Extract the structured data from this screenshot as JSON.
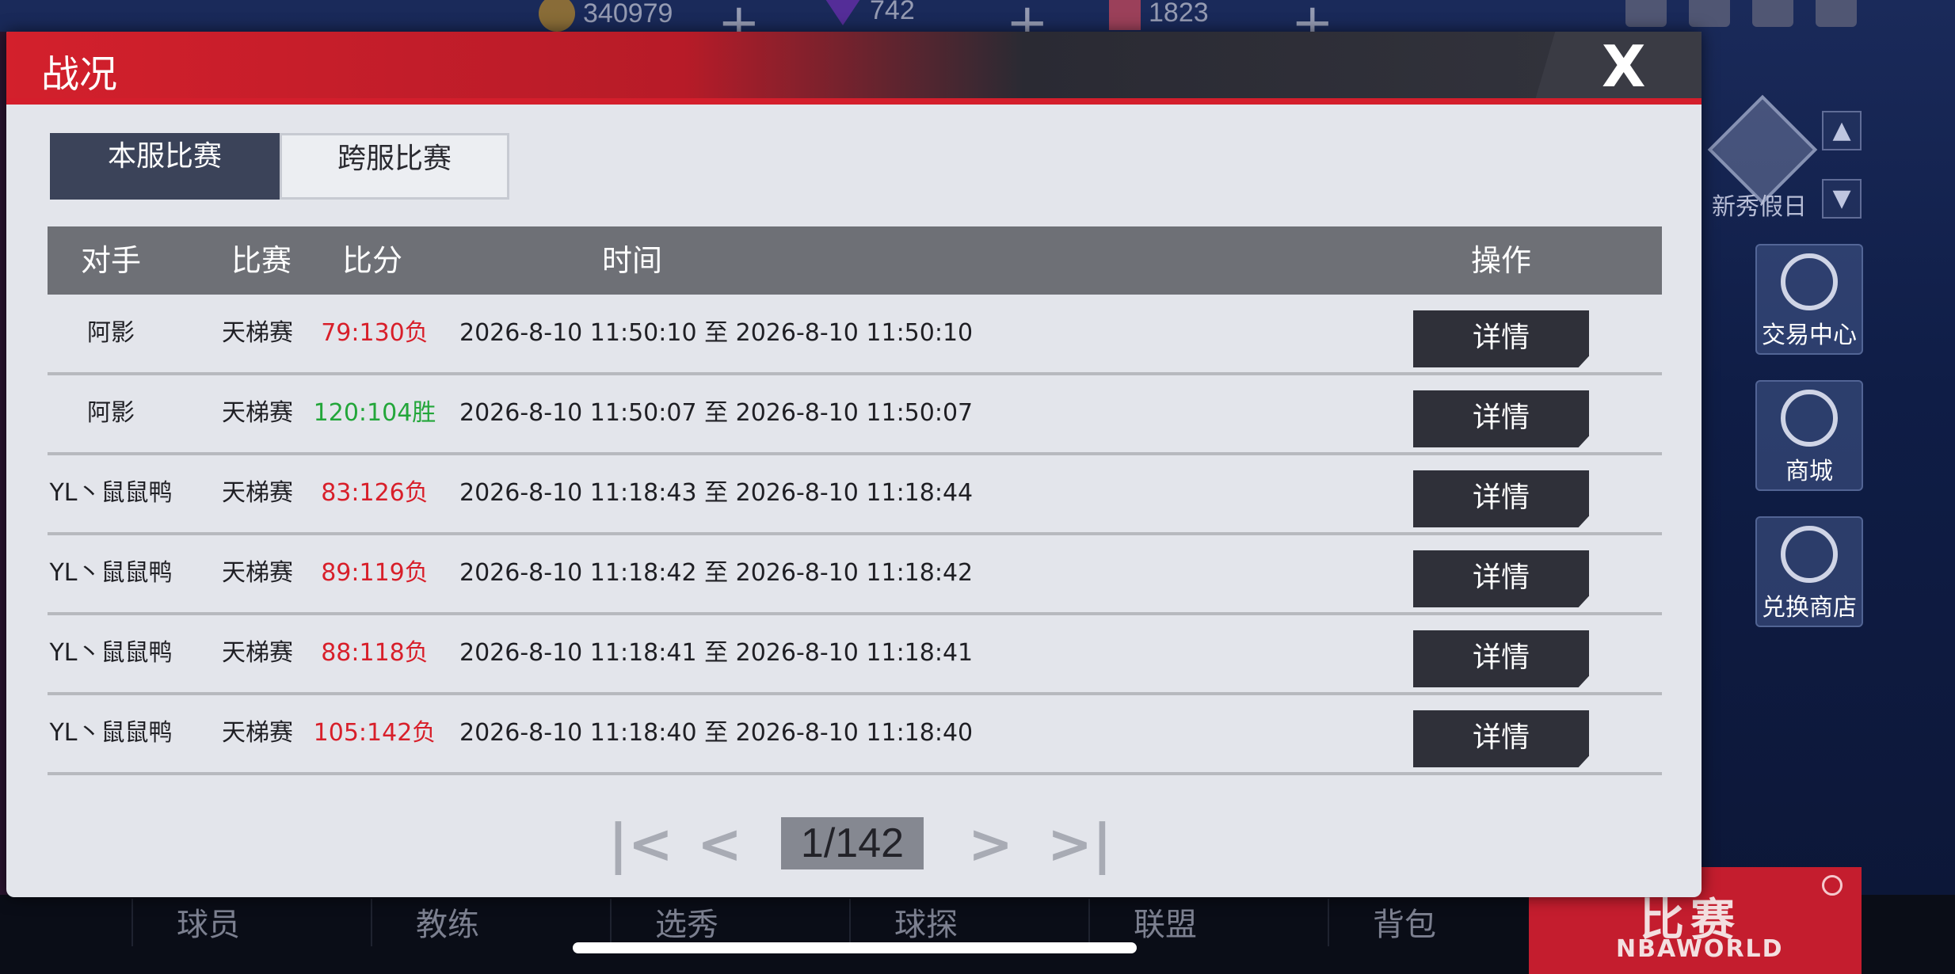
{
  "background": {
    "resources": [
      {
        "name": "coin",
        "value": "340979"
      },
      {
        "name": "gem",
        "value": "742"
      },
      {
        "name": "card",
        "value": "1823"
      }
    ],
    "side_menu": {
      "holiday": "新秀假日",
      "trade": "交易中心",
      "shop": "商城",
      "exchange": "兑换商店"
    },
    "bottom_nav": [
      "球员",
      "教练",
      "选秀",
      "球探",
      "联盟",
      "背包"
    ],
    "match_button": {
      "title": "比赛",
      "subtitle": "NBAWORLD"
    }
  },
  "dialog": {
    "title": "战况",
    "close_icon": "close-x-icon",
    "tabs": [
      {
        "label": "本服比赛",
        "active": true
      },
      {
        "label": "跨服比赛",
        "active": false
      }
    ],
    "columns": {
      "opponent": "对手",
      "match": "比赛",
      "score": "比分",
      "time": "时间",
      "action": "操作"
    },
    "rows": [
      {
        "opponent": "阿影",
        "match": "天梯赛",
        "score": "79:130负",
        "result": "lose",
        "time": "2026-8-10 11:50:10 至 2026-8-10 11:50:10",
        "action": "详情"
      },
      {
        "opponent": "阿影",
        "match": "天梯赛",
        "score": "120:104胜",
        "result": "win",
        "time": "2026-8-10 11:50:07 至 2026-8-10 11:50:07",
        "action": "详情"
      },
      {
        "opponent": "YL丶鼠鼠鸭",
        "match": "天梯赛",
        "score": "83:126负",
        "result": "lose",
        "time": "2026-8-10 11:18:43 至 2026-8-10 11:18:44",
        "action": "详情"
      },
      {
        "opponent": "YL丶鼠鼠鸭",
        "match": "天梯赛",
        "score": "89:119负",
        "result": "lose",
        "time": "2026-8-10 11:18:42 至 2026-8-10 11:18:42",
        "action": "详情"
      },
      {
        "opponent": "YL丶鼠鼠鸭",
        "match": "天梯赛",
        "score": "88:118负",
        "result": "lose",
        "time": "2026-8-10 11:18:41 至 2026-8-10 11:18:41",
        "action": "详情"
      },
      {
        "opponent": "YL丶鼠鼠鸭",
        "match": "天梯赛",
        "score": "105:142负",
        "result": "lose",
        "time": "2026-8-10 11:18:40 至 2026-8-10 11:18:40",
        "action": "详情"
      }
    ],
    "pagination": {
      "page": "1/142"
    },
    "colors": {
      "lose": "#d81f2a",
      "win": "#23a63a",
      "header_red": "#d3202c"
    }
  }
}
